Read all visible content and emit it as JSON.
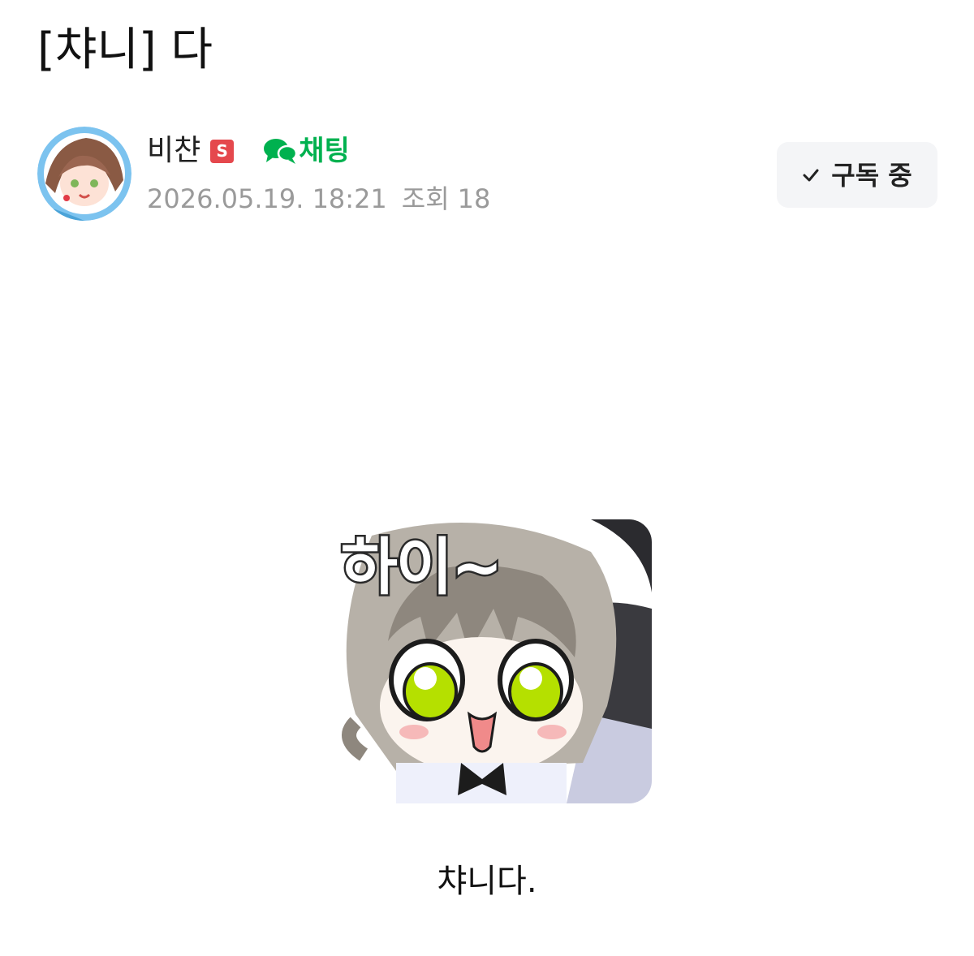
{
  "post": {
    "title": "[챠니] 다",
    "body_text": "챠니다."
  },
  "author": {
    "name": "비챤",
    "level_badge": "S",
    "chat_label": "채팅",
    "date": "2026.05.19. 18:21",
    "views_label": "조회",
    "views_count": "18"
  },
  "subscribe": {
    "label": "구독 중",
    "icon": "check-icon"
  },
  "sticker": {
    "caption": "하이~"
  },
  "colors": {
    "chat_green": "#00b14f",
    "badge_red": "#e5484d",
    "meta_gray": "#9a9a9a",
    "button_bg": "#f4f5f7"
  },
  "icons": {
    "chat": "chat-bubbles-icon",
    "check": "check-icon"
  }
}
